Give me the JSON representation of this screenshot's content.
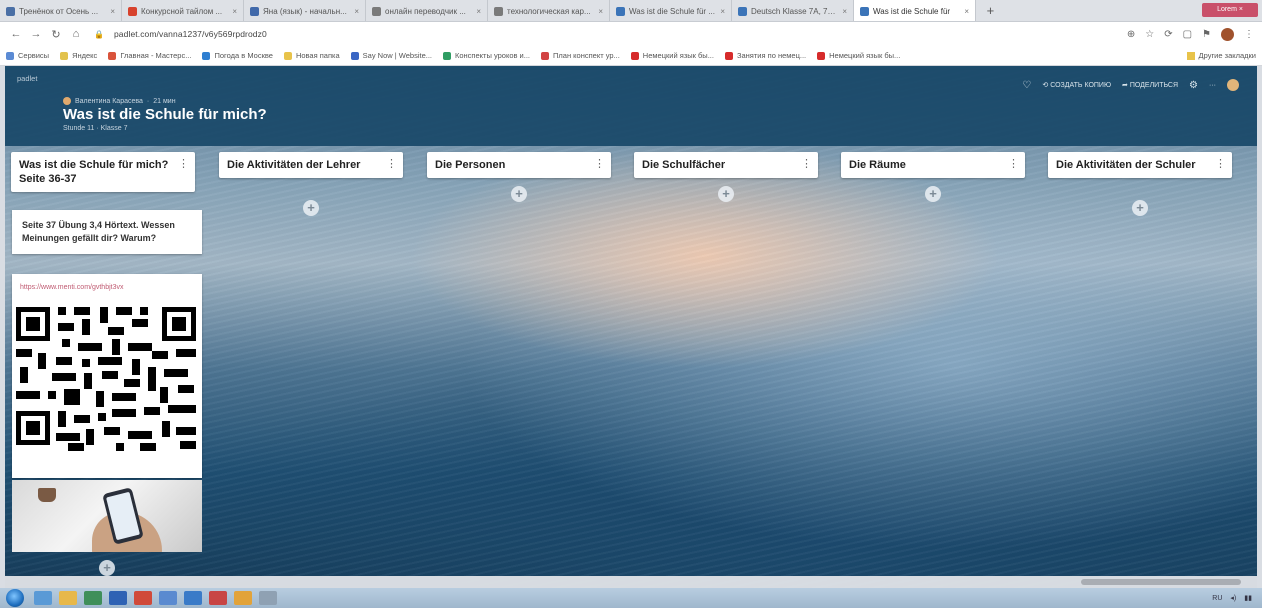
{
  "browser": {
    "tabs": [
      {
        "title": "Тренёнок от Осень ...",
        "color": "#4a6fa5"
      },
      {
        "title": "Конкурсной тайлом ...",
        "color": "#d7422d"
      },
      {
        "title": "Яна (язык) - начальн...",
        "color": "#4169aa"
      },
      {
        "title": "онлайн переводчик ...",
        "color": "#7a7a7a"
      },
      {
        "title": "технологическая кар...",
        "color": "#7a7a7a"
      },
      {
        "title": "Was ist die Schule für ...",
        "color": "#3b74b8"
      },
      {
        "title": "Deutsch Klasse 7А, 7Б ...",
        "color": "#3b74b8"
      },
      {
        "title": "Was ist die Schule für",
        "color": "#3b74b8",
        "active": true
      }
    ],
    "new_tab": "+",
    "url": "padlet.com/vanna1237/v6y569rpdrodz0",
    "window_controls": "Lorem  ×",
    "bookmarks": [
      {
        "label": "Сервисы",
        "color": "#5b8bd4"
      },
      {
        "label": "Яндекс",
        "color": "#e2c24c"
      },
      {
        "label": "Главная - Мастерс...",
        "color": "#d9533b"
      },
      {
        "label": "Погода в Москве",
        "color": "#2f7fd1"
      },
      {
        "label": "Новая папка",
        "color": "#e8c34a"
      },
      {
        "label": "Say Now | Website...",
        "color": "#3a66c4"
      },
      {
        "label": "Конспекты уроков и...",
        "color": "#2f9d63"
      },
      {
        "label": "План конспект ур...",
        "color": "#d24343"
      },
      {
        "label": "Немецкий язык бы...",
        "color": "#d62b2b"
      },
      {
        "label": "Занятия по немец...",
        "color": "#d62b2b"
      },
      {
        "label": "Немецкий язык бы...",
        "color": "#d62b2b"
      }
    ],
    "bookmarks_right": "Другие закладки"
  },
  "board": {
    "logo": "padlet",
    "author": "Валентина Карасева",
    "time": "21 мин",
    "title": "Was ist die Schule für mich?",
    "subtitle": "Stunde 11 · Klasse 7",
    "actions": {
      "remake": "СОЗДАТЬ КОПИЮ",
      "share": "ПОДЕЛИТЬСЯ",
      "more": "···"
    },
    "columns": [
      {
        "title": "Was ist die Schule für mich? Seite 36-37"
      },
      {
        "title": "Die Aktivitäten der Lehrer"
      },
      {
        "title": "Die Personen"
      },
      {
        "title": "Die Schulfächer"
      },
      {
        "title": "Die Räume"
      },
      {
        "title": "Die Aktivitäten der Schuler"
      }
    ],
    "add_post_label": "+",
    "column_menu_icon": "⋮",
    "posts": {
      "exercise": "Seite 37 Übung 3,4 Hörtext. Wessen Meinungen gefällt dir? Warum?",
      "link": "https://www.menti.com/gvthbjt3vx"
    }
  },
  "taskbar": {
    "apps": [
      "#5a9ad6",
      "#e7b84a",
      "#3f8f5a",
      "#2e62b4",
      "#d04a3a",
      "#5a8ad0",
      "#3a7bc8",
      "#c84545",
      "#e2a33a",
      "#8fa1b3"
    ],
    "tray": "RU"
  }
}
